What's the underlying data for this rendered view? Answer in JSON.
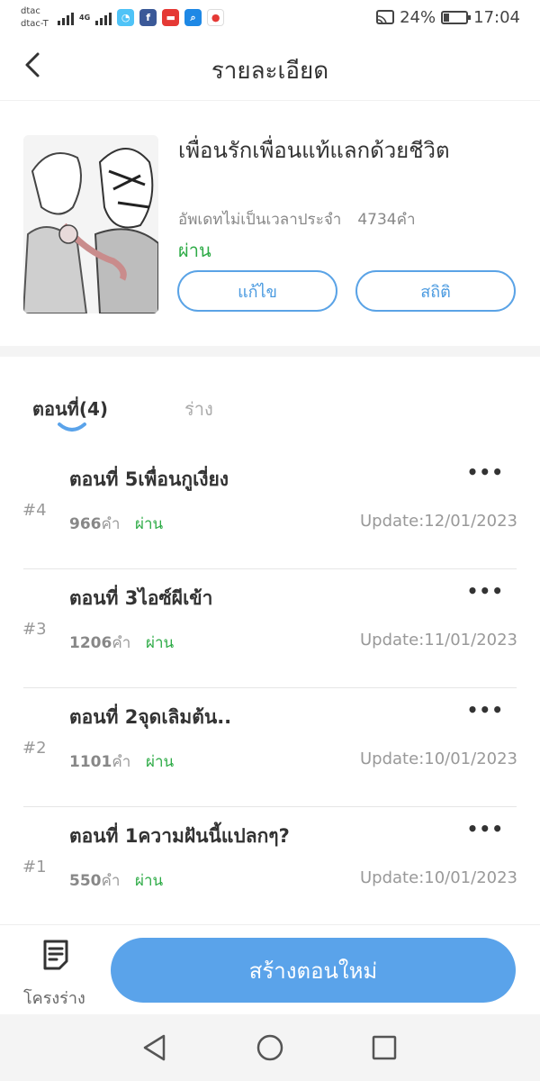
{
  "status_bar": {
    "carrier_1": "dtac",
    "carrier_2": "dtac-T",
    "network": "4G",
    "battery": "24%",
    "time": "17:04"
  },
  "header": {
    "title": "รายละเอียด"
  },
  "book": {
    "title": "เพื่อนรักเพื่อนแท้แลกด้วยชีวิต",
    "update_schedule": "อัพเดทไม่เป็นเวลาประจำ",
    "word_count": "4734คำ",
    "status": "ผ่าน",
    "edit_label": "แก้ไข",
    "stats_label": "สถิติ"
  },
  "tabs": {
    "episodes_label": "ตอนที่(4)",
    "drafts_label": "ร่าง"
  },
  "episodes": [
    {
      "index": "#4",
      "title": "ตอนที่ 5เพื่อนกูเงี่ยง",
      "words": "966",
      "words_unit": "คำ",
      "status": "ผ่าน",
      "update": "Update:12/01/2023"
    },
    {
      "index": "#3",
      "title": "ตอนที่ 3ไอซ์ผีเข้า",
      "words": "1206",
      "words_unit": "คำ",
      "status": "ผ่าน",
      "update": "Update:11/01/2023"
    },
    {
      "index": "#2",
      "title": "ตอนที่ 2จุดเลิมต้น..",
      "words": "1101",
      "words_unit": "คำ",
      "status": "ผ่าน",
      "update": "Update:10/01/2023"
    },
    {
      "index": "#1",
      "title": "ตอนที่ 1ความฝันนี้แปลกๆ?",
      "words": "550",
      "words_unit": "คำ",
      "status": "ผ่าน",
      "update": "Update:10/01/2023"
    }
  ],
  "more_label": "•••",
  "bottom_bar": {
    "drafts_label": "โครงร่าง",
    "create_label": "สร้างตอนใหม่"
  },
  "colors": {
    "accent": "#5aa3ea",
    "status_green": "#2dab46"
  }
}
